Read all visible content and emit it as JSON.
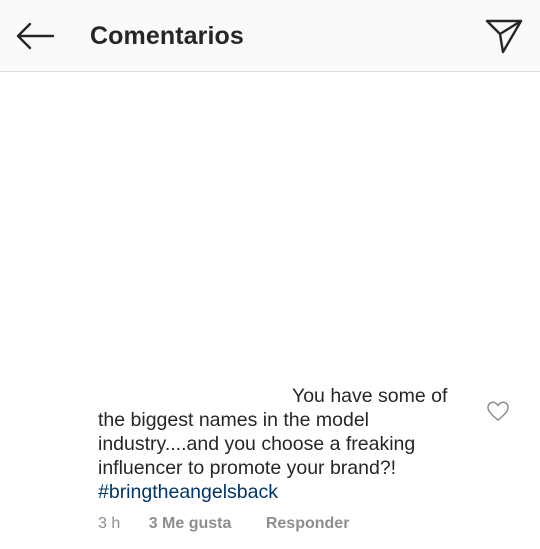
{
  "header": {
    "title": "Comentarios",
    "back_icon": "arrow-left-icon",
    "share_icon": "paper-plane-icon"
  },
  "comment": {
    "text": "You have some of the biggest names in the model industry....and you choose a freaking influencer to promote your brand?!",
    "hashtag": "#bringtheangelsback",
    "time": "3 h",
    "likes": "3 Me gusta",
    "reply_label": "Responder",
    "like_icon": "heart-outline-icon"
  },
  "colors": {
    "hashtag": "#003569",
    "meta": "#8e8e8e",
    "text": "#262626",
    "divider": "#dbdbdb"
  }
}
